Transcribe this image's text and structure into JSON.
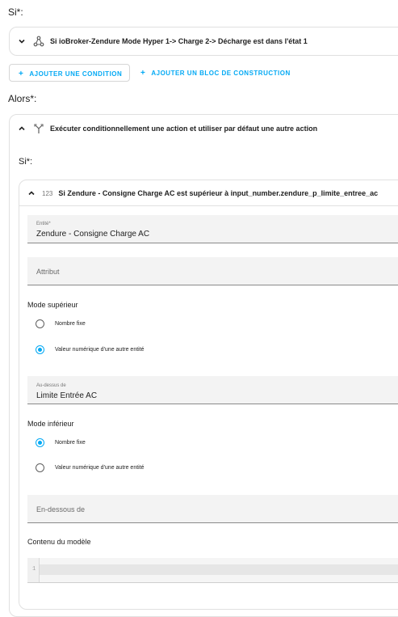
{
  "if_label": "Si*:",
  "condition_card": {
    "title": "Si ioBroker-Zendure Mode Hyper 1-> Charge 2-> Décharge est dans l'état 1",
    "icon": "state-node-icon"
  },
  "buttons": {
    "add_condition": "AJOUTER UNE CONDITION",
    "add_building_block": "AJOUTER UN BLOC DE CONSTRUCTION",
    "plus": "+"
  },
  "then_label": "Alors*:",
  "action_card": {
    "title": "Exécuter conditionnellement une action et utiliser par défaut une autre action",
    "icon": "branch-icon",
    "inner_if_label": "Si*:",
    "numeric_condition": {
      "badge": "123",
      "title": "Si Zendure - Consigne Charge AC est supérieur à input_number.zendure_p_limite_entree_ac",
      "entity_label": "Entité*",
      "entity_value": "Zendure - Consigne Charge AC",
      "attribute_placeholder": "Attribut",
      "above_mode_label": "Mode supérieur",
      "above_options": [
        {
          "label": "Nombre fixe",
          "checked": false
        },
        {
          "label": "Valeur numérique d'une autre entité",
          "checked": true
        }
      ],
      "above_label": "Au-dessus de",
      "above_value": "Limite Entrée AC",
      "below_mode_label": "Mode inférieur",
      "below_options": [
        {
          "label": "Nombre fixe",
          "checked": true
        },
        {
          "label": "Valeur numérique d'une autre entité",
          "checked": false
        }
      ],
      "below_placeholder": "En-dessous de",
      "template_label": "Contenu du modèle",
      "editor_line_number": "1"
    }
  },
  "colors": {
    "accent": "#03a9f4",
    "field_bg": "#f3f3f3",
    "border": "#e0e0e0"
  }
}
